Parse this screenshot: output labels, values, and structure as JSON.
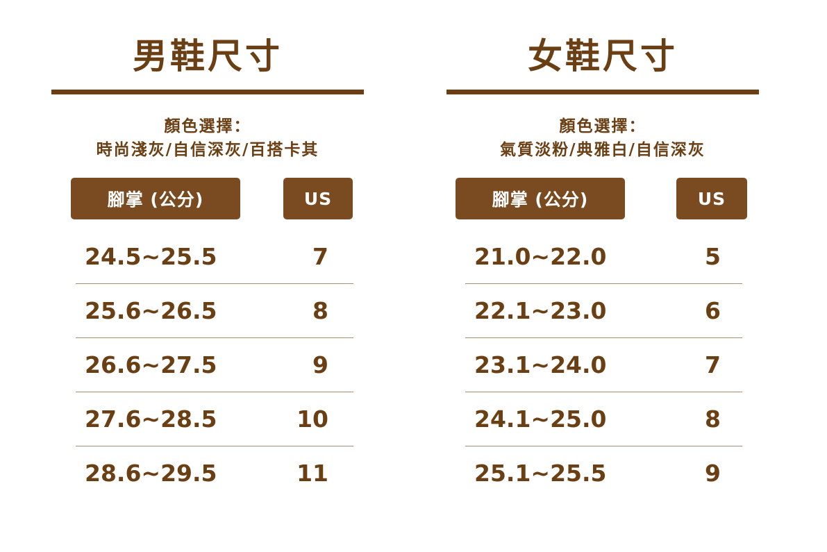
{
  "men": {
    "title": "男鞋尺寸",
    "color_label": "顏色選擇：",
    "colors": "時尚淺灰/自信深灰/百搭卡其",
    "header_foot": "腳掌 (公分)",
    "header_us": "US",
    "rows": [
      {
        "foot": "24.5~25.5",
        "us": "7"
      },
      {
        "foot": "25.6~26.5",
        "us": "8"
      },
      {
        "foot": "26.6~27.5",
        "us": "9"
      },
      {
        "foot": "27.6~28.5",
        "us": "10"
      },
      {
        "foot": "28.6~29.5",
        "us": "11"
      }
    ]
  },
  "women": {
    "title": "女鞋尺寸",
    "color_label": "顏色選擇：",
    "colors": "氣質淡粉/典雅白/自信深灰",
    "header_foot": "腳掌 (公分)",
    "header_us": "US",
    "rows": [
      {
        "foot": "21.0~22.0",
        "us": "5"
      },
      {
        "foot": "22.1~23.0",
        "us": "6"
      },
      {
        "foot": "23.1~24.0",
        "us": "7"
      },
      {
        "foot": "24.1~25.0",
        "us": "8"
      },
      {
        "foot": "25.1~25.5",
        "us": "9"
      }
    ]
  },
  "colors": {
    "accent": "#7a4a21",
    "text": "#6b3f14",
    "divider": "#a88d70"
  }
}
